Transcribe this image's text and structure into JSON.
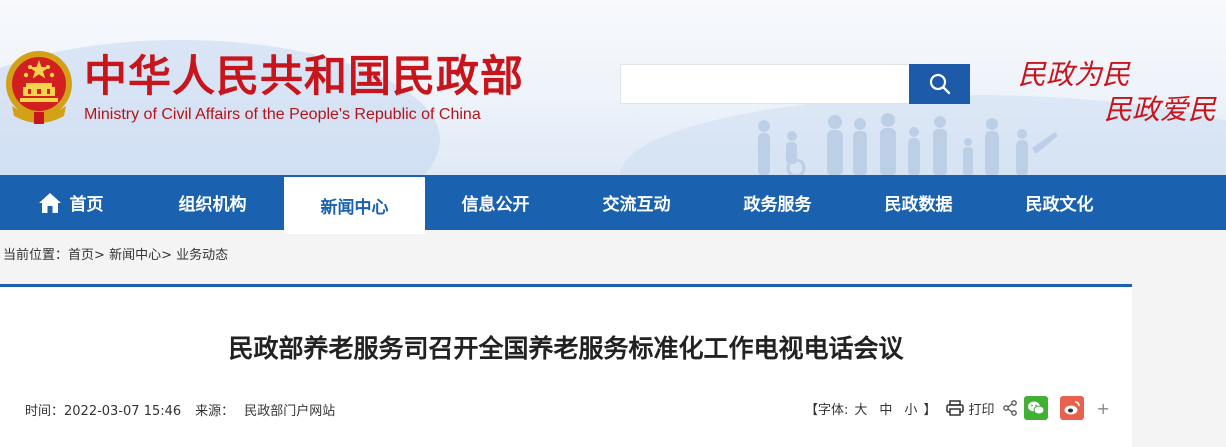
{
  "header": {
    "site_name_cn": "中华人民共和国民政部",
    "site_name_en": "Ministry of Civil Affairs of the People's Republic of China",
    "search": {
      "placeholder": "",
      "value": ""
    },
    "slogan_line1": "民政为民",
    "slogan_line2": "民政爱民"
  },
  "nav": {
    "items": [
      {
        "label": "首页"
      },
      {
        "label": "组织机构"
      },
      {
        "label": "新闻中心"
      },
      {
        "label": "信息公开"
      },
      {
        "label": "交流互动"
      },
      {
        "label": "政务服务"
      },
      {
        "label": "民政数据"
      },
      {
        "label": "民政文化"
      }
    ],
    "active_index": 2
  },
  "breadcrumb": {
    "prefix": "当前位置：",
    "items": [
      "首页",
      "新闻中心",
      "业务动态"
    ],
    "separator": ">"
  },
  "article": {
    "title": "民政部养老服务司召开全国养老服务标准化工作电视电话会议",
    "time_label": "时间：",
    "time_value": "2022-03-07 15:46",
    "source_label": "来源：",
    "source_value": "民政部门户网站",
    "font_size_label": "【字体:",
    "font_size_options": [
      "大",
      "中",
      "小"
    ],
    "font_size_close": "】",
    "print_label": "打印",
    "plus_label": "+"
  },
  "colors": {
    "primary_blue": "#1a62b0",
    "brand_red": "#c8141b",
    "wechat_green": "#41b035",
    "weibo_orange": "#e8614d"
  },
  "icons": [
    "emblem-icon",
    "search-icon",
    "home-icon",
    "print-icon",
    "share-icon",
    "wechat-icon",
    "weibo-icon",
    "plus-icon"
  ]
}
